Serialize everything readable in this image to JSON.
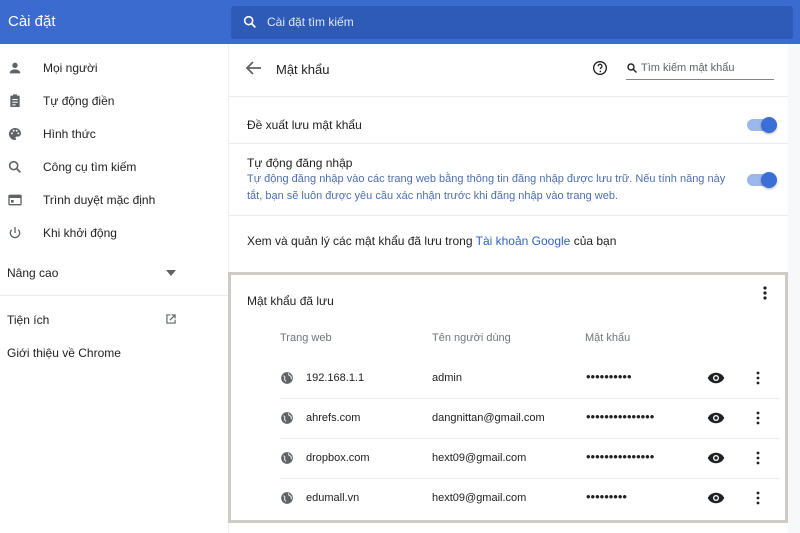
{
  "app": {
    "title": "Cài đặt"
  },
  "search": {
    "placeholder": "Cài đặt tìm kiếm"
  },
  "sidebar": {
    "items": [
      {
        "label": "Mọi người",
        "icon": "person-icon"
      },
      {
        "label": "Tự động điền",
        "icon": "clipboard-icon"
      },
      {
        "label": "Hình thức",
        "icon": "palette-icon"
      },
      {
        "label": "Công cụ tìm kiếm",
        "icon": "search-icon"
      },
      {
        "label": "Trình duyệt mặc định",
        "icon": "browser-icon"
      },
      {
        "label": "Khi khởi động",
        "icon": "power-icon"
      }
    ],
    "advanced": "Nâng cao",
    "extensions": "Tiện ích",
    "about": "Giới thiệu về Chrome"
  },
  "passwords_page": {
    "title": "Mật khẩu",
    "search_placeholder": "Tìm kiếm mật khẩu",
    "offer_to_save": {
      "label": "Đề xuất lưu mật khẩu",
      "enabled": true
    },
    "auto_signin": {
      "label": "Tự động đăng nhập",
      "description": "Tự động đăng nhập vào các trang web bằng thông tin đăng nhập được lưu trữ. Nếu tính năng này tắt, bạn sẽ luôn được yêu cầu xác nhận trước khi đăng nhập vào trang web.",
      "enabled": true
    },
    "manage_text": "Xem và quản lý các mật khẩu đã lưu trong",
    "manage_link": "Tài khoản Google",
    "manage_suffix": "của bạn",
    "saved": {
      "title": "Mật khẩu đã lưu",
      "columns": [
        "Trang web",
        "Tên người dùng",
        "Mật khẩu"
      ],
      "rows": [
        {
          "site": "192.168.1.1",
          "user": "admin",
          "password_mask": "••••••••••"
        },
        {
          "site": "ahrefs.com",
          "user": "dangnittan@gmail.com",
          "password_mask": "•••••••••••••••"
        },
        {
          "site": "dropbox.com",
          "user": "hext09@gmail.com",
          "password_mask": "•••••••••••••••"
        },
        {
          "site": "edumall.vn",
          "user": "hext09@gmail.com",
          "password_mask": "•••••••••"
        }
      ]
    }
  },
  "colors": {
    "header": "#3b6bcf",
    "accent": "#3a6fd8",
    "link": "#2f62c4"
  }
}
